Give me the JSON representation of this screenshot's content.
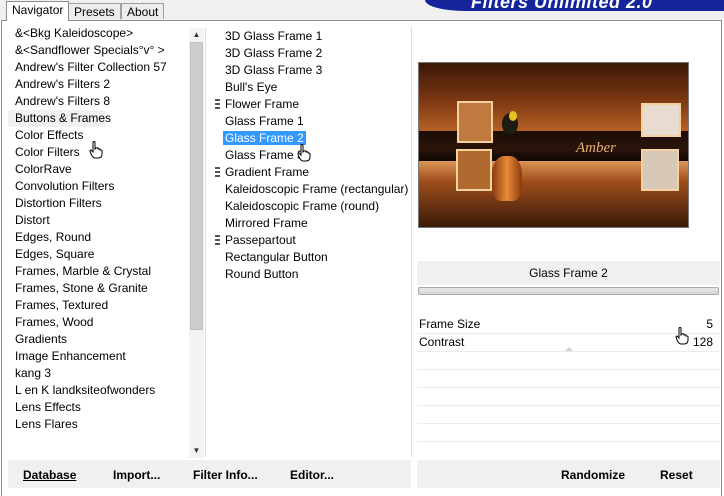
{
  "tabs": [
    {
      "label": "Navigator",
      "active": true
    },
    {
      "label": "Presets",
      "active": false
    },
    {
      "label": "About",
      "active": false
    }
  ],
  "banner": {
    "title": "Filters Unlimited 2.0"
  },
  "categories": {
    "selected": "Buttons & Frames",
    "items": [
      "&<Bkg Kaleidoscope>",
      "&<Sandflower Specials°v° >",
      "Andrew's Filter Collection 57",
      "Andrew's Filters 2",
      "Andrew's Filters 8",
      "Buttons & Frames",
      "Color Effects",
      "Color Filters",
      "ColorRave",
      "Convolution Filters",
      "Distortion Filters",
      "Distort",
      "Edges, Round",
      "Edges, Square",
      "Frames, Marble & Crystal",
      "Frames, Stone & Granite",
      "Frames, Textured",
      "Frames, Wood",
      "Gradients",
      "Image Enhancement",
      "kang 3",
      "L en K landksiteofwonders",
      "Lens Effects",
      "Lens Flares"
    ]
  },
  "filters": {
    "selected": "Glass Frame 2",
    "items": [
      {
        "label": "3D Glass Frame 1",
        "marker": false
      },
      {
        "label": "3D Glass Frame 2",
        "marker": false
      },
      {
        "label": "3D Glass Frame 3",
        "marker": false
      },
      {
        "label": "Bull's Eye",
        "marker": false
      },
      {
        "label": "Flower Frame",
        "marker": true
      },
      {
        "label": "Glass Frame 1",
        "marker": false
      },
      {
        "label": "Glass Frame 2",
        "marker": false
      },
      {
        "label": "Glass Frame 3",
        "marker": false
      },
      {
        "label": "Gradient Frame",
        "marker": true
      },
      {
        "label": "Kaleidoscopic Frame (rectangular)",
        "marker": false
      },
      {
        "label": "Kaleidoscopic Frame (round)",
        "marker": false
      },
      {
        "label": "Mirrored Frame",
        "marker": false
      },
      {
        "label": "Passepartout",
        "marker": true
      },
      {
        "label": "Rectangular Button",
        "marker": false
      },
      {
        "label": "Round Button",
        "marker": false
      }
    ]
  },
  "preview": {
    "caption": "Amber"
  },
  "current_filter": {
    "name": "Glass Frame 2"
  },
  "parameters": [
    {
      "name": "Frame Size",
      "value": "5"
    },
    {
      "name": "Contrast",
      "value": "128"
    }
  ],
  "buttons": {
    "database": "Database",
    "import": "Import...",
    "filter_info": "Filter Info...",
    "editor": "Editor...",
    "randomize": "Randomize",
    "reset": "Reset"
  },
  "colors": {
    "selection": "#3399ff",
    "banner": "#15249a"
  }
}
